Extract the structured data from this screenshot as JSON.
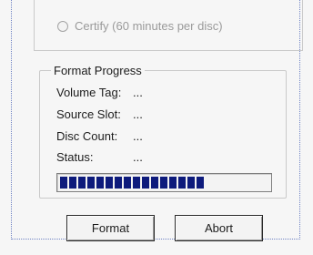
{
  "burn_mode": {
    "certify_option": "Certify (60 minutes per disc)",
    "certify_selected": false
  },
  "format_progress": {
    "title": "Format Progress",
    "fields": [
      {
        "label": "Volume Tag:",
        "value": "..."
      },
      {
        "label": "Source Slot:",
        "value": "..."
      },
      {
        "label": "Disc Count:",
        "value": "..."
      },
      {
        "label": "Status:",
        "value": "..."
      }
    ],
    "progress_fraction": 0.72,
    "progress_color": "#0e1b7c"
  },
  "buttons": {
    "format": "Format",
    "abort": "Abort"
  }
}
